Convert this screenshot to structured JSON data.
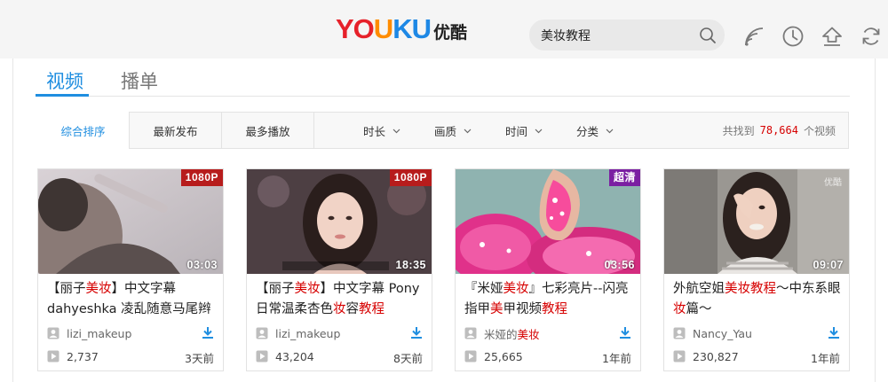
{
  "header": {
    "logo": {
      "latin": "YOUKU",
      "chinese": "优酷"
    },
    "search": {
      "value": "美妆教程",
      "icon": "search-icon"
    },
    "icons": [
      "wifi-icon",
      "history-clock-icon",
      "upload-icon",
      "refresh-icon"
    ]
  },
  "tabs": [
    {
      "label": "视频",
      "active": true
    },
    {
      "label": "播单",
      "active": false
    }
  ],
  "sort_buttons": [
    {
      "label": "综合排序",
      "active": true
    },
    {
      "label": "最新发布",
      "active": false
    },
    {
      "label": "最多播放",
      "active": false
    }
  ],
  "filters": [
    {
      "label": "时长"
    },
    {
      "label": "画质"
    },
    {
      "label": "时间"
    },
    {
      "label": "分类"
    }
  ],
  "result_count": {
    "prefix": "共找到",
    "value": "78,664",
    "suffix": "个视频"
  },
  "colors": {
    "accent": "#1f8ee0",
    "highlight": "#d60000",
    "badge_hd": "#b71c1c",
    "badge_super": "#7b1fa2"
  },
  "videos": [
    {
      "badge": "1080P",
      "duration": "03:03",
      "title_parts": [
        {
          "text": "【丽子",
          "hl": false
        },
        {
          "text": "美妆",
          "hl": true
        },
        {
          "text": "】中文字幕 dahyeshka 凌乱随意马尾辫",
          "hl": false
        }
      ],
      "user_parts": [
        {
          "text": "lizi_makeup",
          "hl": false
        }
      ],
      "plays": "2,737",
      "ago": "3天前"
    },
    {
      "badge": "1080P",
      "duration": "18:35",
      "title_parts": [
        {
          "text": "【丽子",
          "hl": false
        },
        {
          "text": "美妆",
          "hl": true
        },
        {
          "text": "】中文字幕 Pony日常温柔杏色",
          "hl": false
        },
        {
          "text": "妆",
          "hl": true
        },
        {
          "text": "容",
          "hl": false
        },
        {
          "text": "教程",
          "hl": true
        }
      ],
      "user_parts": [
        {
          "text": "lizi_makeup",
          "hl": false
        }
      ],
      "plays": "43,204",
      "ago": "8天前"
    },
    {
      "badge": "超清",
      "duration": "03:56",
      "title_parts": [
        {
          "text": "『米娅",
          "hl": false
        },
        {
          "text": "美妆",
          "hl": true
        },
        {
          "text": "』七彩亮片--闪亮指甲",
          "hl": false
        },
        {
          "text": "美",
          "hl": true
        },
        {
          "text": "甲视频",
          "hl": false
        },
        {
          "text": "教程",
          "hl": true
        }
      ],
      "user_parts": [
        {
          "text": "米娅的",
          "hl": false
        },
        {
          "text": "美妆",
          "hl": true
        }
      ],
      "plays": "25,665",
      "ago": "1年前"
    },
    {
      "badge": "",
      "watermark": "优酷",
      "duration": "09:07",
      "title_parts": [
        {
          "text": "外航空姐",
          "hl": false
        },
        {
          "text": "美妆教程",
          "hl": true
        },
        {
          "text": "～中东系眼",
          "hl": false
        },
        {
          "text": "妆",
          "hl": true
        },
        {
          "text": "篇～",
          "hl": false
        }
      ],
      "user_parts": [
        {
          "text": "Nancy_Yau",
          "hl": false
        }
      ],
      "plays": "230,827",
      "ago": "1年前"
    }
  ]
}
